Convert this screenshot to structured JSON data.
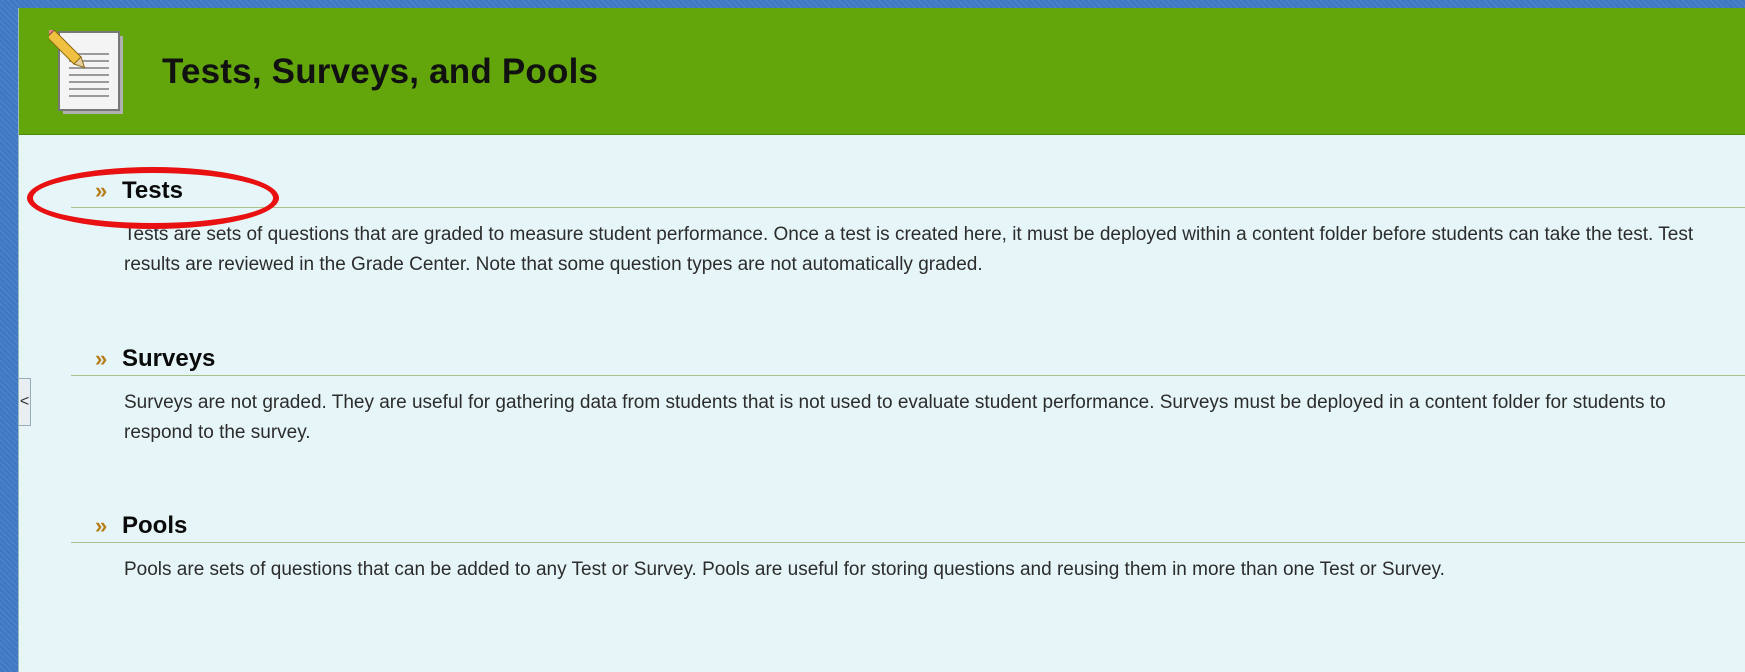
{
  "page": {
    "title": "Tests, Surveys, and Pools",
    "icon": "document-pencil-icon"
  },
  "sections": [
    {
      "title": "Tests",
      "chevron": "»",
      "description": "Tests are sets of questions that are graded to measure student performance. Once a test is created here, it must be deployed within a content folder before students can take the test. Test results are reviewed in the Grade Center. Note that some question types are not automatically graded."
    },
    {
      "title": "Surveys",
      "chevron": "»",
      "description": "Surveys are not graded. They are useful for gathering data from students that is not used to evaluate student performance. Surveys must be deployed in a content folder for students to respond to the survey."
    },
    {
      "title": "Pools",
      "chevron": "»",
      "description": "Pools are sets of questions that can be added to any Test or Survey. Pools are useful for storing questions and reusing them in more than one Test or Survey."
    }
  ],
  "sidebar_toggle": {
    "glyph": "<",
    "icon": "chevron-left-icon"
  },
  "annotation": {
    "color": "#e81010",
    "target": "Tests"
  },
  "colors": {
    "header": "#63a60b",
    "content_background": "#e6f5f7",
    "chevron": "#b57e17",
    "desktop_background": "#3f78c4"
  }
}
